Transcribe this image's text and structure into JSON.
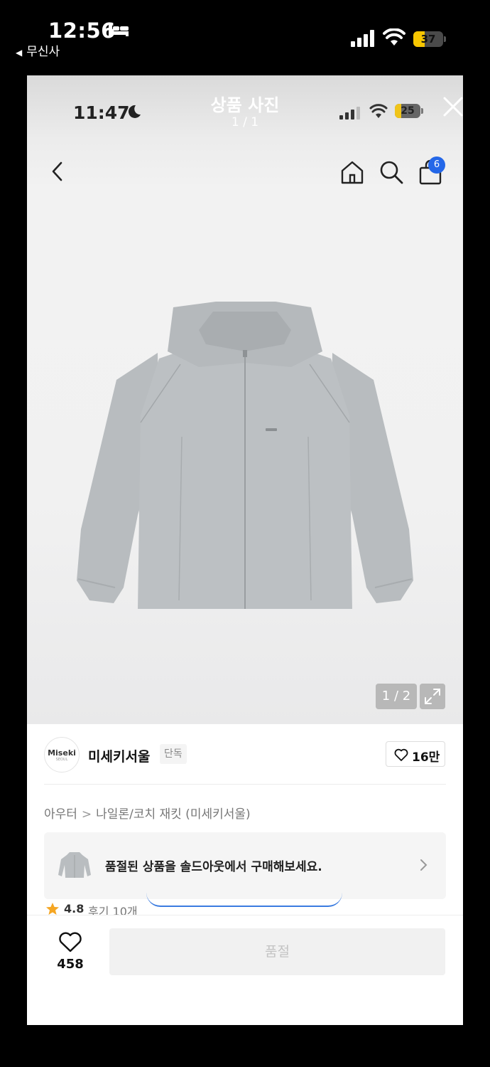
{
  "outer_status": {
    "time": "12:56",
    "back_app": "무신사",
    "battery_level": "37",
    "battery_fraction": 0.37
  },
  "viewer": {
    "inner_time": "11:47",
    "title": "상품 사진",
    "counter": "1 / 1",
    "inner_battery": "25",
    "inner_battery_fraction": 0.25,
    "cart_badge": "6",
    "image_counter": "1 / 2"
  },
  "brand": {
    "logo_text": "Miseki",
    "logo_sub": "SEOUL",
    "name": "미세키서울",
    "exclusive_tag": "단독",
    "likes": "16만"
  },
  "breadcrumb": {
    "category": "아우터",
    "separator": ">",
    "subcategory": "나일론/코치 재킷 (미세키서울)"
  },
  "soldout_banner": {
    "text": "품절된 상품을 솔드아웃에서 구매해보세요."
  },
  "rating": {
    "score": "4.8",
    "reviews": "후기 10개"
  },
  "bottom_bar": {
    "wish_count": "458",
    "buy_label": "품절"
  },
  "colors": {
    "accent_blue": "#2467e8",
    "rating_star": "#f5a623",
    "battery_yellow": "#f7c600"
  },
  "icons": [
    "bed-icon",
    "signal-icon",
    "wifi-icon",
    "battery-icon",
    "moon-icon",
    "close-icon",
    "back-arrow-icon",
    "home-icon",
    "search-icon",
    "shopping-bag-icon",
    "expand-icon",
    "heart-icon",
    "chevron-right-icon",
    "star-icon"
  ]
}
